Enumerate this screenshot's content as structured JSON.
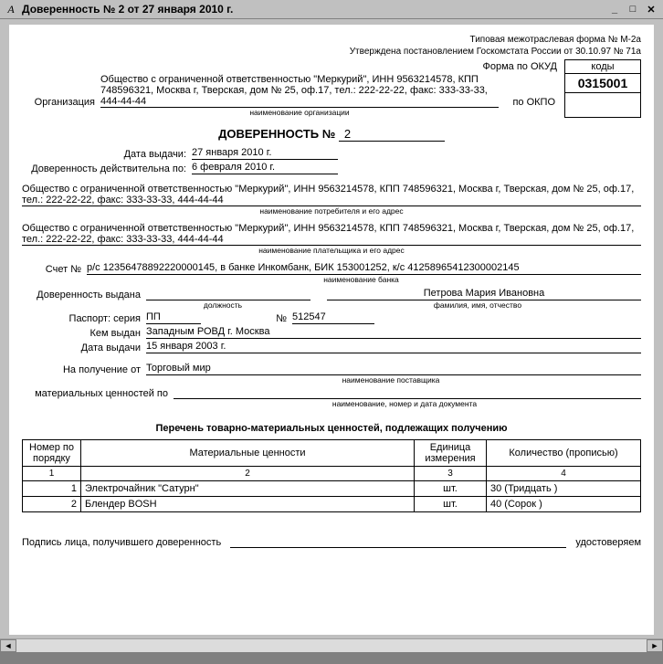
{
  "window": {
    "title": "Доверенность № 2 от 27 января 2010 г.",
    "icon_label": "A"
  },
  "header": {
    "form_type": "Типовая межотраслевая форма № М-2а",
    "approved": "Утверждена постановлением Госкомстата России от 30.10.97 № 71а",
    "okud_label": "Форма по ОКУД",
    "okpo_label": "по ОКПО",
    "codes_header": "коды",
    "okud_code": "0315001",
    "okpo_code": ""
  },
  "org": {
    "label": "Организация",
    "text": "Общество с ограниченной ответственностью \"Меркурий\", ИНН 9563214578, КПП 748596321, Москва г, Тверская, дом № 25, оф.17, тел.: 222-22-22, факс: 333-33-33, 444-44-44",
    "subcaption": "наименование организации"
  },
  "doc": {
    "title": "ДОВЕРЕННОСТЬ №",
    "number": "2",
    "issue_label": "Дата выдачи:",
    "issue_date": "27 января 2010 г.",
    "valid_label": "Доверенность действительна по:",
    "valid_date": "6 февраля 2010 г."
  },
  "consumer": {
    "text": "Общество с ограниченной ответственностью \"Меркурий\", ИНН 9563214578, КПП 748596321, Москва г, Тверская, дом № 25, оф.17, тел.: 222-22-22, факс: 333-33-33, 444-44-44",
    "subcaption": "наименование потребителя и его адрес"
  },
  "payer": {
    "text": "Общество с ограниченной ответственностью \"Меркурий\", ИНН 9563214578, КПП 748596321, Москва г, Тверская, дом № 25, оф.17, тел.: 222-22-22, факс: 333-33-33, 444-44-44",
    "subcaption": "наименование плательщика и его адрес"
  },
  "account": {
    "label": "Счет №",
    "text": "р/с 12356478892220000145, в банке Инкомбанк, БИК 153001252, к/с 41258965412300002145",
    "subcaption": "наименование банка"
  },
  "person": {
    "issued_label": "Доверенность выдана",
    "position": "",
    "position_sub": "должность",
    "name": "Петрова Мария Ивановна",
    "name_sub": "фамилия, имя, отчество",
    "passport_label": "Паспорт: серия",
    "passport_series": "ПП",
    "passport_no_label": "№",
    "passport_no": "512547",
    "issuer_label": "Кем выдан",
    "issuer": "Западным РОВД г. Москва",
    "date_label": "Дата выдачи",
    "date": "15 января 2003 г."
  },
  "supplier": {
    "receive_label": "На получение от",
    "name": "Торговый мир",
    "subcaption": "наименование поставщика",
    "valuables_label": "материальных ценностей по",
    "valuables_value": "",
    "valuables_sub": "наименование, номер и дата документа"
  },
  "table": {
    "caption": "Перечень товарно-материальных ценностей, подлежащих получению",
    "headers": {
      "num": "Номер по порядку",
      "item": "Материальные ценности",
      "unit": "Единица измерения",
      "qty": "Количество (прописью)"
    },
    "colnums": [
      "1",
      "2",
      "3",
      "4"
    ],
    "rows": [
      {
        "n": "1",
        "item": "Электрочайник \"Сатурн\"",
        "unit": "шт.",
        "qty": "30 (Тридцать )"
      },
      {
        "n": "2",
        "item": "Блендер BOSH",
        "unit": "шт.",
        "qty": "40 (Сорок )"
      }
    ]
  },
  "signature": {
    "label": "Подпись лица, получившего доверенность",
    "confirm": "удостоверяем"
  }
}
